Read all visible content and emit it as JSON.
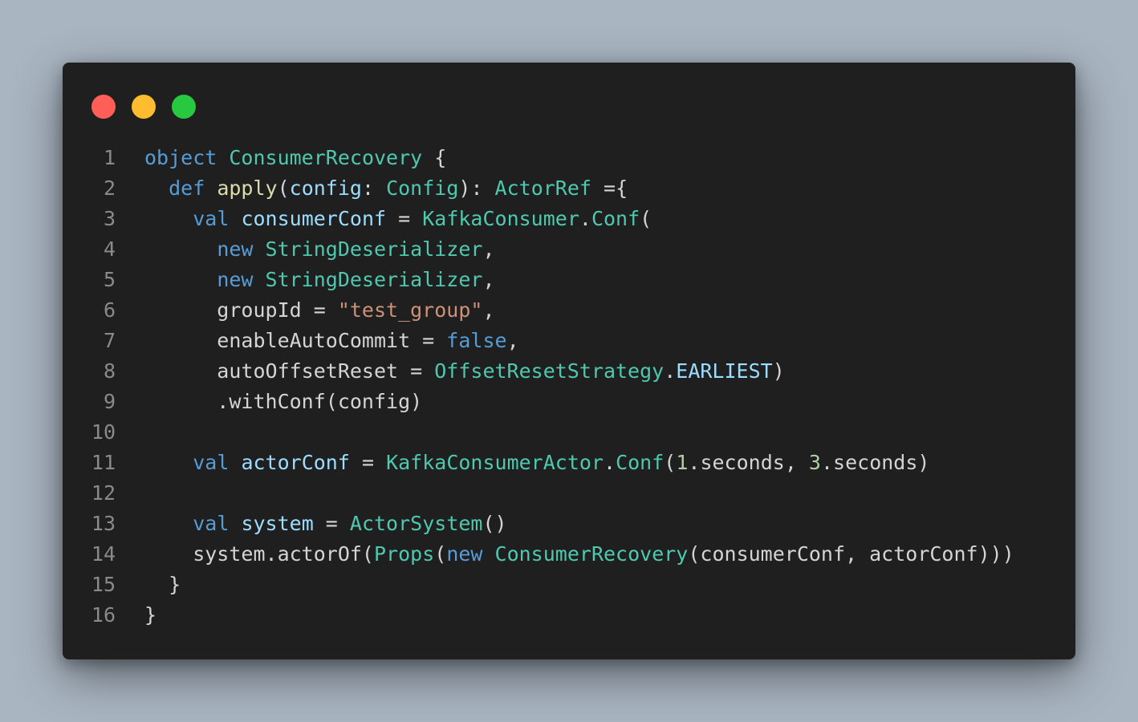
{
  "window": {
    "controls": [
      {
        "name": "close",
        "color": "#ff5f57"
      },
      {
        "name": "minimize",
        "color": "#febc2e"
      },
      {
        "name": "maximize",
        "color": "#28c840"
      }
    ]
  },
  "code": {
    "lines": [
      {
        "n": "1",
        "tokens": [
          {
            "t": "object",
            "k": "keyword"
          },
          {
            "t": " ",
            "k": "plain"
          },
          {
            "t": "ConsumerRecovery",
            "k": "type"
          },
          {
            "t": " {",
            "k": "plain"
          }
        ]
      },
      {
        "n": "2",
        "tokens": [
          {
            "t": "  ",
            "k": "plain"
          },
          {
            "t": "def",
            "k": "keyword"
          },
          {
            "t": " ",
            "k": "plain"
          },
          {
            "t": "apply",
            "k": "func"
          },
          {
            "t": "(",
            "k": "plain"
          },
          {
            "t": "config",
            "k": "param"
          },
          {
            "t": ": ",
            "k": "plain"
          },
          {
            "t": "Config",
            "k": "type"
          },
          {
            "t": "): ",
            "k": "plain"
          },
          {
            "t": "ActorRef",
            "k": "type"
          },
          {
            "t": " ={",
            "k": "plain"
          }
        ]
      },
      {
        "n": "3",
        "tokens": [
          {
            "t": "    ",
            "k": "plain"
          },
          {
            "t": "val",
            "k": "keyword"
          },
          {
            "t": " ",
            "k": "plain"
          },
          {
            "t": "consumerConf",
            "k": "param"
          },
          {
            "t": " = ",
            "k": "plain"
          },
          {
            "t": "KafkaConsumer",
            "k": "type"
          },
          {
            "t": ".",
            "k": "plain"
          },
          {
            "t": "Conf",
            "k": "type"
          },
          {
            "t": "(",
            "k": "plain"
          }
        ]
      },
      {
        "n": "4",
        "tokens": [
          {
            "t": "      ",
            "k": "plain"
          },
          {
            "t": "new",
            "k": "keyword"
          },
          {
            "t": " ",
            "k": "plain"
          },
          {
            "t": "StringDeserializer",
            "k": "type"
          },
          {
            "t": ",",
            "k": "plain"
          }
        ]
      },
      {
        "n": "5",
        "tokens": [
          {
            "t": "      ",
            "k": "plain"
          },
          {
            "t": "new",
            "k": "keyword"
          },
          {
            "t": " ",
            "k": "plain"
          },
          {
            "t": "StringDeserializer",
            "k": "type"
          },
          {
            "t": ",",
            "k": "plain"
          }
        ]
      },
      {
        "n": "6",
        "tokens": [
          {
            "t": "      groupId = ",
            "k": "plain"
          },
          {
            "t": "\"test_group\"",
            "k": "string"
          },
          {
            "t": ",",
            "k": "plain"
          }
        ]
      },
      {
        "n": "7",
        "tokens": [
          {
            "t": "      enableAutoCommit = ",
            "k": "plain"
          },
          {
            "t": "false",
            "k": "keyword"
          },
          {
            "t": ",",
            "k": "plain"
          }
        ]
      },
      {
        "n": "8",
        "tokens": [
          {
            "t": "      autoOffsetReset = ",
            "k": "plain"
          },
          {
            "t": "OffsetResetStrategy",
            "k": "type"
          },
          {
            "t": ".",
            "k": "plain"
          },
          {
            "t": "EARLIEST",
            "k": "param"
          },
          {
            "t": ")",
            "k": "plain"
          }
        ]
      },
      {
        "n": "9",
        "tokens": [
          {
            "t": "      .withConf(config)",
            "k": "plain"
          }
        ]
      },
      {
        "n": "10",
        "tokens": []
      },
      {
        "n": "11",
        "tokens": [
          {
            "t": "    ",
            "k": "plain"
          },
          {
            "t": "val",
            "k": "keyword"
          },
          {
            "t": " ",
            "k": "plain"
          },
          {
            "t": "actorConf",
            "k": "param"
          },
          {
            "t": " = ",
            "k": "plain"
          },
          {
            "t": "KafkaConsumerActor",
            "k": "type"
          },
          {
            "t": ".",
            "k": "plain"
          },
          {
            "t": "Conf",
            "k": "type"
          },
          {
            "t": "(",
            "k": "plain"
          },
          {
            "t": "1",
            "k": "number"
          },
          {
            "t": ".seconds, ",
            "k": "plain"
          },
          {
            "t": "3",
            "k": "number"
          },
          {
            "t": ".seconds)",
            "k": "plain"
          }
        ]
      },
      {
        "n": "12",
        "tokens": []
      },
      {
        "n": "13",
        "tokens": [
          {
            "t": "    ",
            "k": "plain"
          },
          {
            "t": "val",
            "k": "keyword"
          },
          {
            "t": " ",
            "k": "plain"
          },
          {
            "t": "system",
            "k": "param"
          },
          {
            "t": " = ",
            "k": "plain"
          },
          {
            "t": "ActorSystem",
            "k": "type"
          },
          {
            "t": "()",
            "k": "plain"
          }
        ]
      },
      {
        "n": "14",
        "tokens": [
          {
            "t": "    system.actorOf(",
            "k": "plain"
          },
          {
            "t": "Props",
            "k": "type"
          },
          {
            "t": "(",
            "k": "plain"
          },
          {
            "t": "new",
            "k": "keyword"
          },
          {
            "t": " ",
            "k": "plain"
          },
          {
            "t": "ConsumerRecovery",
            "k": "type"
          },
          {
            "t": "(consumerConf, actorConf)))",
            "k": "plain"
          }
        ]
      },
      {
        "n": "15",
        "tokens": [
          {
            "t": "  }",
            "k": "plain"
          }
        ]
      },
      {
        "n": "16",
        "tokens": [
          {
            "t": "}",
            "k": "plain"
          }
        ]
      }
    ]
  }
}
